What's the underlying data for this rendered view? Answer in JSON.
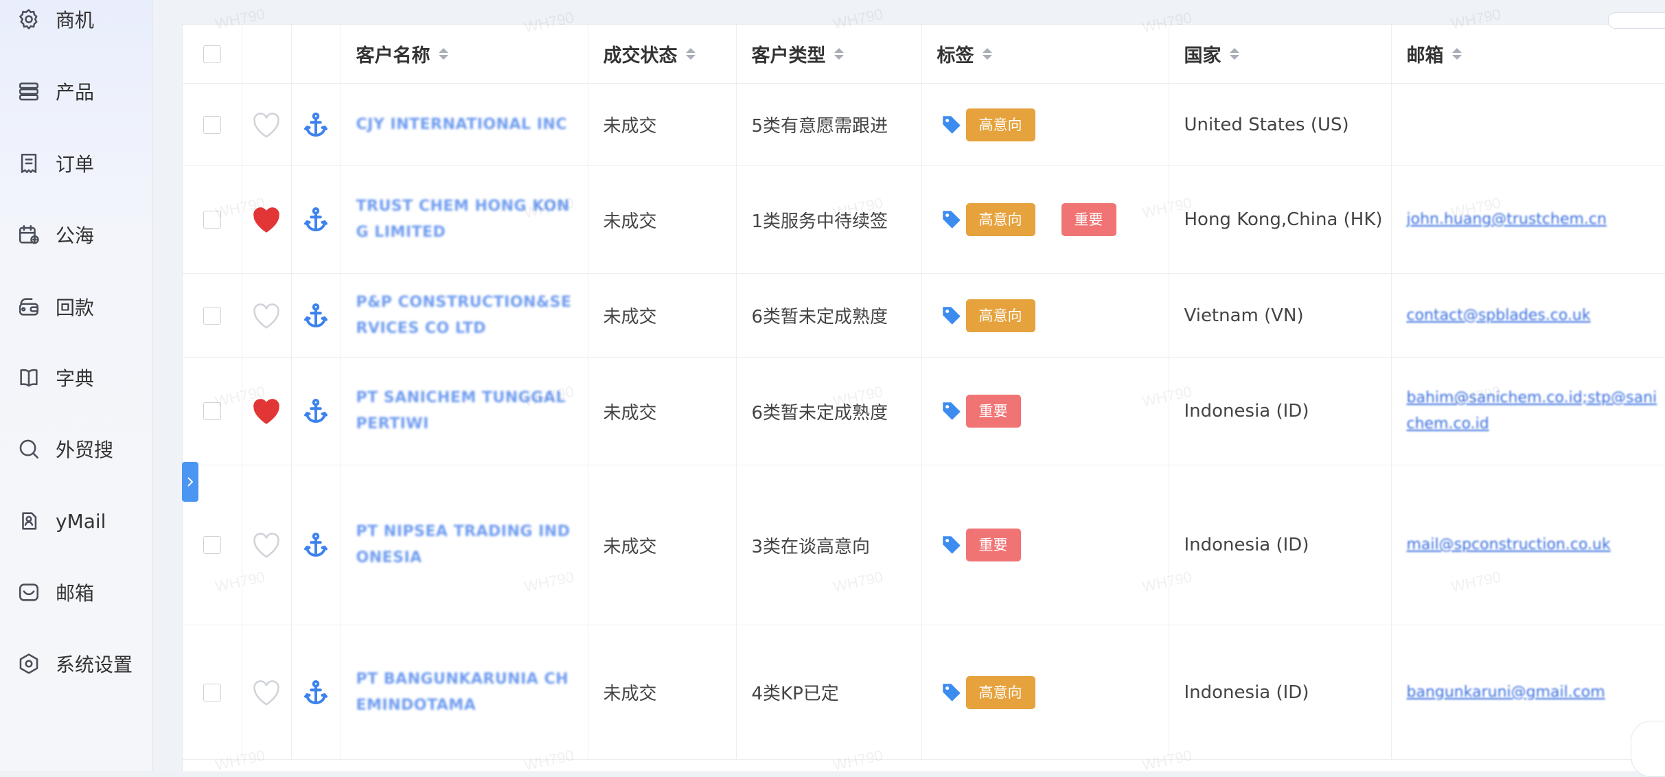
{
  "sidebar": {
    "items": [
      {
        "label": "商机",
        "icon": "opportunity-gear-icon"
      },
      {
        "label": "产品",
        "icon": "product-stack-icon"
      },
      {
        "label": "订单",
        "icon": "order-receipt-icon"
      },
      {
        "label": "公海",
        "icon": "public-pool-calendar-icon"
      },
      {
        "label": "回款",
        "icon": "payment-wallet-icon"
      },
      {
        "label": "字典",
        "icon": "dictionary-book-icon"
      },
      {
        "label": "外贸搜",
        "icon": "search-icon"
      },
      {
        "label": "yMail",
        "icon": "ymail-icon"
      },
      {
        "label": "邮箱",
        "icon": "mailbox-icon"
      },
      {
        "label": "系统设置",
        "icon": "settings-hexagon-icon"
      }
    ]
  },
  "table": {
    "columns": [
      "客户名称",
      "成交状态",
      "客户类型",
      "标签",
      "国家",
      "邮箱"
    ],
    "rows": [
      {
        "name": "CJY INTERNATIONAL INC",
        "status": "未成交",
        "type": "5类有意愿需跟进",
        "tags": [
          "高意向"
        ],
        "country": "United States (US)",
        "email": "",
        "favorite": false
      },
      {
        "name": "TRUST CHEM HONG KONG LIMITED",
        "status": "未成交",
        "type": "1类服务中待续签",
        "tags": [
          "高意向",
          "重要"
        ],
        "country": "Hong Kong,China (HK)",
        "email": "john.huang@trustchem.cn",
        "favorite": true
      },
      {
        "name": "P&P CONSTRUCTION&SERVICES CO LTD",
        "status": "未成交",
        "type": "6类暂未定成熟度",
        "tags": [
          "高意向"
        ],
        "country": "Vietnam (VN)",
        "email": "contact@spblades.co.uk",
        "favorite": false
      },
      {
        "name": "PT SANICHEM TUNGGAL PERTIWI",
        "status": "未成交",
        "type": "6类暂未定成熟度",
        "tags": [
          "重要"
        ],
        "country": "Indonesia (ID)",
        "email": "bahim@sanichem.co.id;stp@sanichem.co.id",
        "favorite": true
      },
      {
        "name": "PT NIPSEA TRADING INDONESIA",
        "status": "未成交",
        "type": "3类在谈高意向",
        "tags": [
          "重要"
        ],
        "country": "Indonesia (ID)",
        "email": "mail@spconstruction.co.uk",
        "favorite": false
      },
      {
        "name": "PT BANGUNKARUNIA CHEMINDOTAMA",
        "status": "未成交",
        "type": "4类KP已定",
        "tags": [
          "高意向"
        ],
        "country": "Indonesia (ID)",
        "email": "bangunkaruni@gmail.com",
        "favorite": false
      }
    ]
  },
  "watermark": "WH790",
  "colors": {
    "tag_high_intent": "#e6a23c",
    "tag_important": "#f07474",
    "heart_filled": "#e23636",
    "accent": "#4b96f3",
    "tag_icon": "#3c8cf0"
  }
}
